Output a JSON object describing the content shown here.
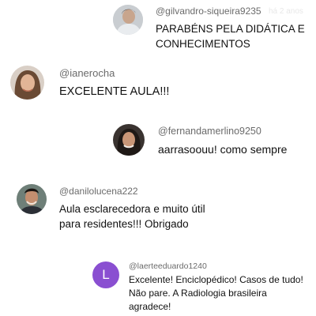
{
  "comments": [
    {
      "handle": "@gilvandro-siqueira9235",
      "text": "PARABÉNS  PELA DIDÁTICA  E CONHECIMENTOS",
      "faint": "há 2 anos",
      "avatar": "photo-avatar"
    },
    {
      "handle": "@ianerocha",
      "text": "EXCELENTE AULA!!!",
      "avatar": "photo-avatar"
    },
    {
      "handle": "@fernandamerlino9250",
      "text": "aarrasoouu! como sempre",
      "avatar": "photo-avatar"
    },
    {
      "handle": "@danilolucena222",
      "text": "Aula esclarecedora e muito útil para residentes!!! Obrigado",
      "avatar": "photo-avatar"
    },
    {
      "handle": "@laerteeduardo1240",
      "text": "Excelente! Enciclopédico! Casos de tudo! Não pare. A Radiologia brasileira agradece!",
      "avatar_letter": "L",
      "avatar_color": "#8a4fd1"
    }
  ]
}
